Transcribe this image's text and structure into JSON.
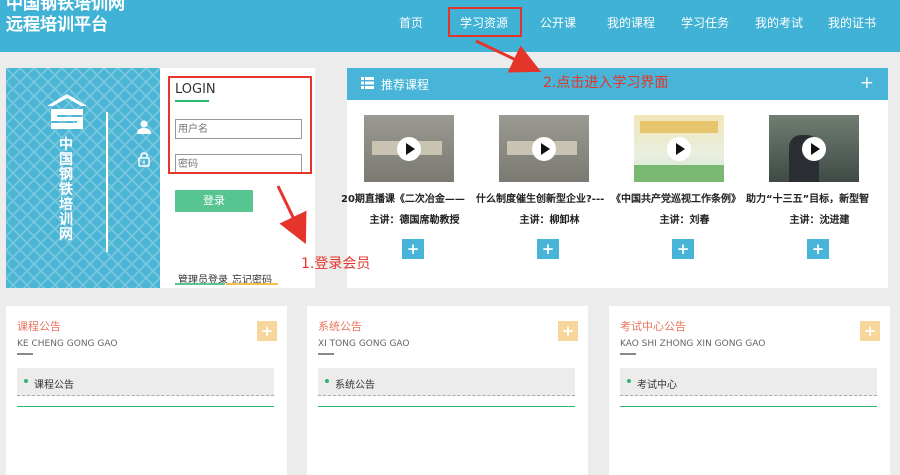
{
  "header": {
    "logo_line1": "中国钢铁培训网",
    "logo_line2": "远程培训平台",
    "nav": [
      "首页",
      "学习资源",
      "公开课",
      "我的课程",
      "学习任务",
      "我的考试",
      "我的证书"
    ]
  },
  "login": {
    "brand_vertical_text": "中国钢铁培训网",
    "title": "LOGIN",
    "username_placeholder": "用户名",
    "password_placeholder": "密码",
    "submit_label": "登录",
    "admin_login": "管理员登录",
    "forgot_password": "忘记密码"
  },
  "annotations": {
    "step1": "1.登录会员",
    "step2": "2.点击进入学习界面",
    "color": "#e5352b"
  },
  "recommend": {
    "title": "推荐课程",
    "plus": "+",
    "courses": [
      {
        "name": "20期直播课《二次冶金——",
        "lecturer": "主讲：德国席勒教授",
        "add": "+"
      },
      {
        "name": "什么制度催生创新型企业?---",
        "lecturer": "主讲：柳卸林",
        "add": "+"
      },
      {
        "name": "《中国共产党巡视工作条例》",
        "lecturer": "主讲：刘春",
        "add": "+"
      },
      {
        "name": "助力“十三五”目标，新型智",
        "lecturer": "主讲：沈进建",
        "add": "+"
      }
    ]
  },
  "notices": [
    {
      "title": "课程公告",
      "subtitle": "KE CHENG GONG GAO",
      "item": "课程公告",
      "plus": "+"
    },
    {
      "title": "系统公告",
      "subtitle": "XI TONG GONG GAO",
      "item": "系统公告",
      "plus": "+"
    },
    {
      "title": "考试中心公告",
      "subtitle": "KAO SHI ZHONG XIN GONG GAO",
      "item": "考试中心",
      "plus": "+"
    }
  ],
  "colors": {
    "header": "#3fb2d6",
    "accent_green": "#2bb673",
    "notice_title": "#e8765e"
  }
}
